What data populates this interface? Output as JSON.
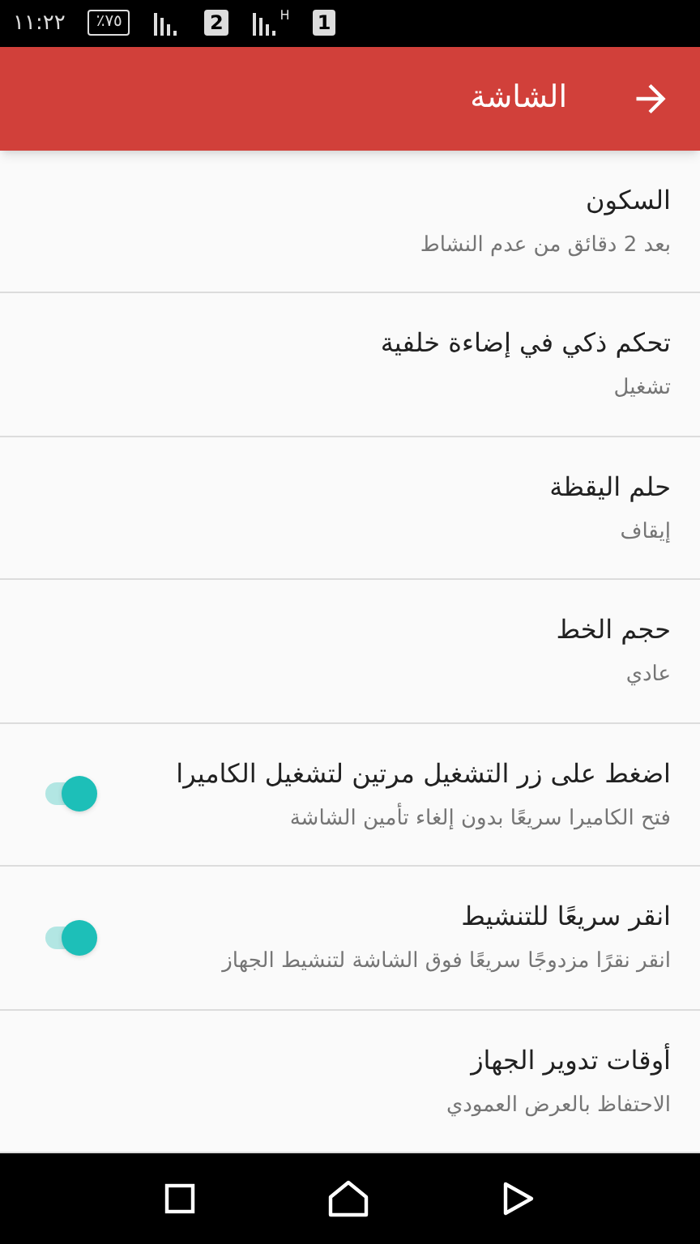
{
  "status_bar": {
    "time": "١١:٢٢",
    "battery": "٪٧٥",
    "sim_2": "2",
    "network_type": "H",
    "sim_1": "1"
  },
  "app_bar": {
    "title": "الشاشة"
  },
  "settings": [
    {
      "kind": "text",
      "title": "السكون",
      "subtitle": "بعد 2 دقائق من عدم النشاط"
    },
    {
      "kind": "text",
      "title": "تحكم ذكي في إضاءة خلفية",
      "subtitle": "تشغيل"
    },
    {
      "kind": "text",
      "title": "حلم اليقظة",
      "subtitle": "إيقاف"
    },
    {
      "kind": "text",
      "title": "حجم الخط",
      "subtitle": "عادي"
    },
    {
      "kind": "switch",
      "title": "اضغط على زر التشغيل مرتين لتشغيل الكاميرا",
      "subtitle": "فتح الكاميرا سريعًا بدون إلغاء تأمين الشاشة",
      "on": true
    },
    {
      "kind": "switch",
      "title": "انقر سريعًا للتنشيط",
      "subtitle": "انقر نقرًا مزدوجًا سريعًا فوق الشاشة لتنشيط الجهاز",
      "on": true
    },
    {
      "kind": "text",
      "title": "أوقات تدوير الجهاز",
      "subtitle": "الاحتفاظ بالعرض العمودي"
    }
  ]
}
